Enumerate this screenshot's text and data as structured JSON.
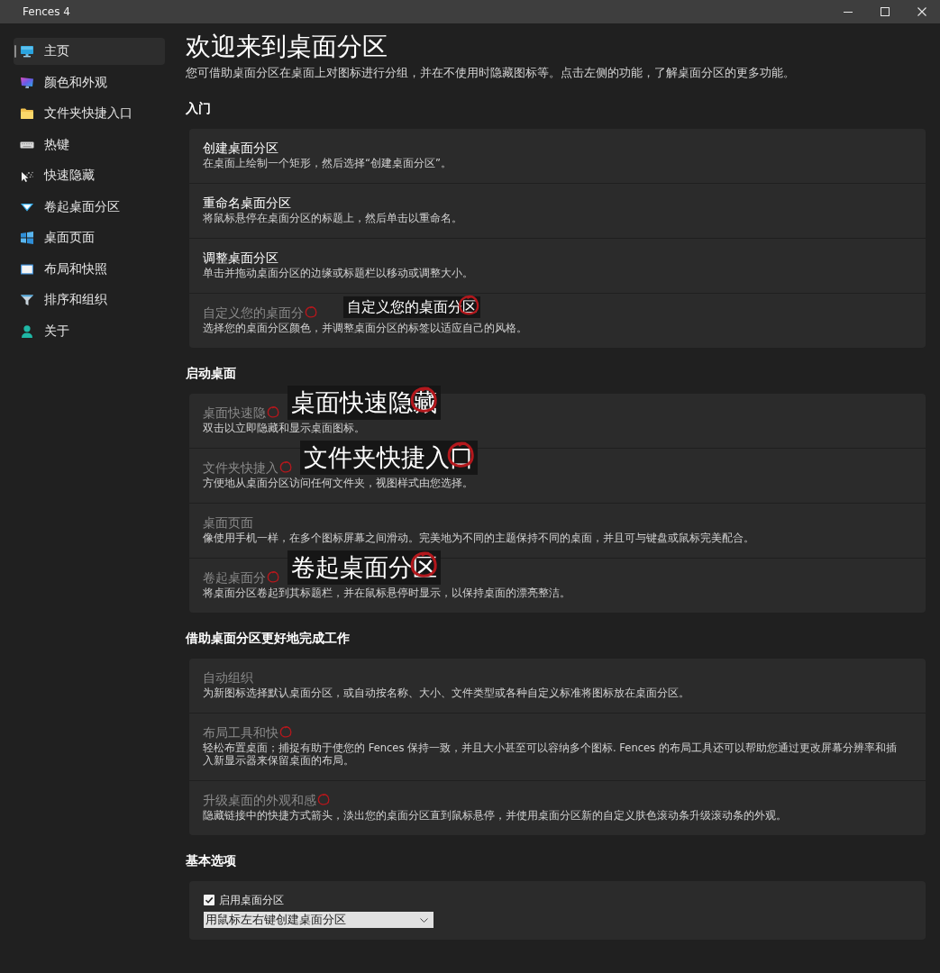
{
  "window": {
    "title": "Fences 4"
  },
  "sidebar": {
    "items": [
      {
        "label": "主页",
        "selected": true
      },
      {
        "label": "颜色和外观",
        "selected": false
      },
      {
        "label": "文件夹快捷入口",
        "selected": false
      },
      {
        "label": "热键",
        "selected": false
      },
      {
        "label": "快速隐藏",
        "selected": false
      },
      {
        "label": "卷起桌面分区",
        "selected": false
      },
      {
        "label": "桌面页面",
        "selected": false
      },
      {
        "label": "布局和快照",
        "selected": false
      },
      {
        "label": "排序和组织",
        "selected": false
      },
      {
        "label": "关于",
        "selected": false
      }
    ]
  },
  "header": {
    "title": "欢迎来到桌面分区",
    "subtitle": "您可借助桌面分区在桌面上对图标进行分组，并在不使用时隐藏图标等。点击左侧的功能，了解桌面分区的更多功能。"
  },
  "sections": [
    {
      "kind": "features",
      "heading": "入门",
      "rows": [
        {
          "title": "创建桌面分区",
          "description": "在桌面上绘制一个矩形，然后选择“创建桌面分区”。",
          "dimmed": false,
          "circled": false
        },
        {
          "title": "重命名桌面分区",
          "description": "将鼠标悬停在桌面分区的标题上，然后单击以重命名。",
          "dimmed": false,
          "circled": false
        },
        {
          "title": "调整桌面分区",
          "description": "单击并拖动桌面分区的边缘或标题栏以移动或调整大小。",
          "dimmed": false,
          "circled": false
        },
        {
          "title": "自定义您的桌面分",
          "description": "选择您的桌面分区颜色，并调整桌面分区的标签以适应自己的风格。",
          "dimmed": true,
          "circled": true,
          "annotation": {
            "text": "自定义您的桌面分区",
            "kind": "small"
          }
        }
      ]
    },
    {
      "kind": "features",
      "heading": "启动桌面",
      "rows": [
        {
          "title": "桌面快速隐",
          "description": "双击以立即隐藏和显示桌面图标。",
          "dimmed": true,
          "circled": true,
          "annotation": {
            "text": "桌面快速隐藏",
            "kind": "large"
          }
        },
        {
          "title": "文件夹快捷入",
          "description": "方便地从桌面分区访问任何文件夹，视图样式由您选择。",
          "dimmed": true,
          "circled": true,
          "annotation": {
            "text": "文件夹快捷入口",
            "kind": "large"
          }
        },
        {
          "title": "桌面页面",
          "description": "像使用手机一样，在多个图标屏幕之间滑动。完美地为不同的主题保持不同的桌面，并且可与键盘或鼠标完美配合。",
          "dimmed": true,
          "circled": false
        },
        {
          "title": "卷起桌面分",
          "description": "将桌面分区卷起到其标题栏，并在鼠标悬停时显示，以保持桌面的漂亮整洁。",
          "dimmed": true,
          "circled": true,
          "annotation": {
            "text": "卷起桌面分区",
            "kind": "large"
          }
        }
      ]
    },
    {
      "kind": "features",
      "heading": "借助桌面分区更好地完成工作",
      "rows": [
        {
          "title": "自动组织",
          "description": "为新图标选择默认桌面分区，或自动按名称、大小、文件类型或各种自定义标准将图标放在桌面分区。",
          "dimmed": true,
          "circled": false
        },
        {
          "title": "布局工具和快",
          "description": "轻松布置桌面；捕捉有助于使您的 Fences 保持一致，并且大小甚至可以容纳多个图标. Fences 的布局工具还可以帮助您通过更改屏幕分辨率和插入新显示器来保留桌面的布局。",
          "dimmed": true,
          "circled": true
        },
        {
          "title": "升级桌面的外观和感",
          "description": "隐藏链接中的快捷方式箭头，淡出您的桌面分区直到鼠标悬停，并使用桌面分区新的自定义肤色滚动条升级滚动条的外观。",
          "dimmed": true,
          "circled": true
        }
      ]
    },
    {
      "kind": "options",
      "heading": "基本选项",
      "checkbox": {
        "label": "启用桌面分区",
        "checked": true
      },
      "dropdown": {
        "value": "用鼠标左右键创建桌面分区"
      }
    }
  ]
}
